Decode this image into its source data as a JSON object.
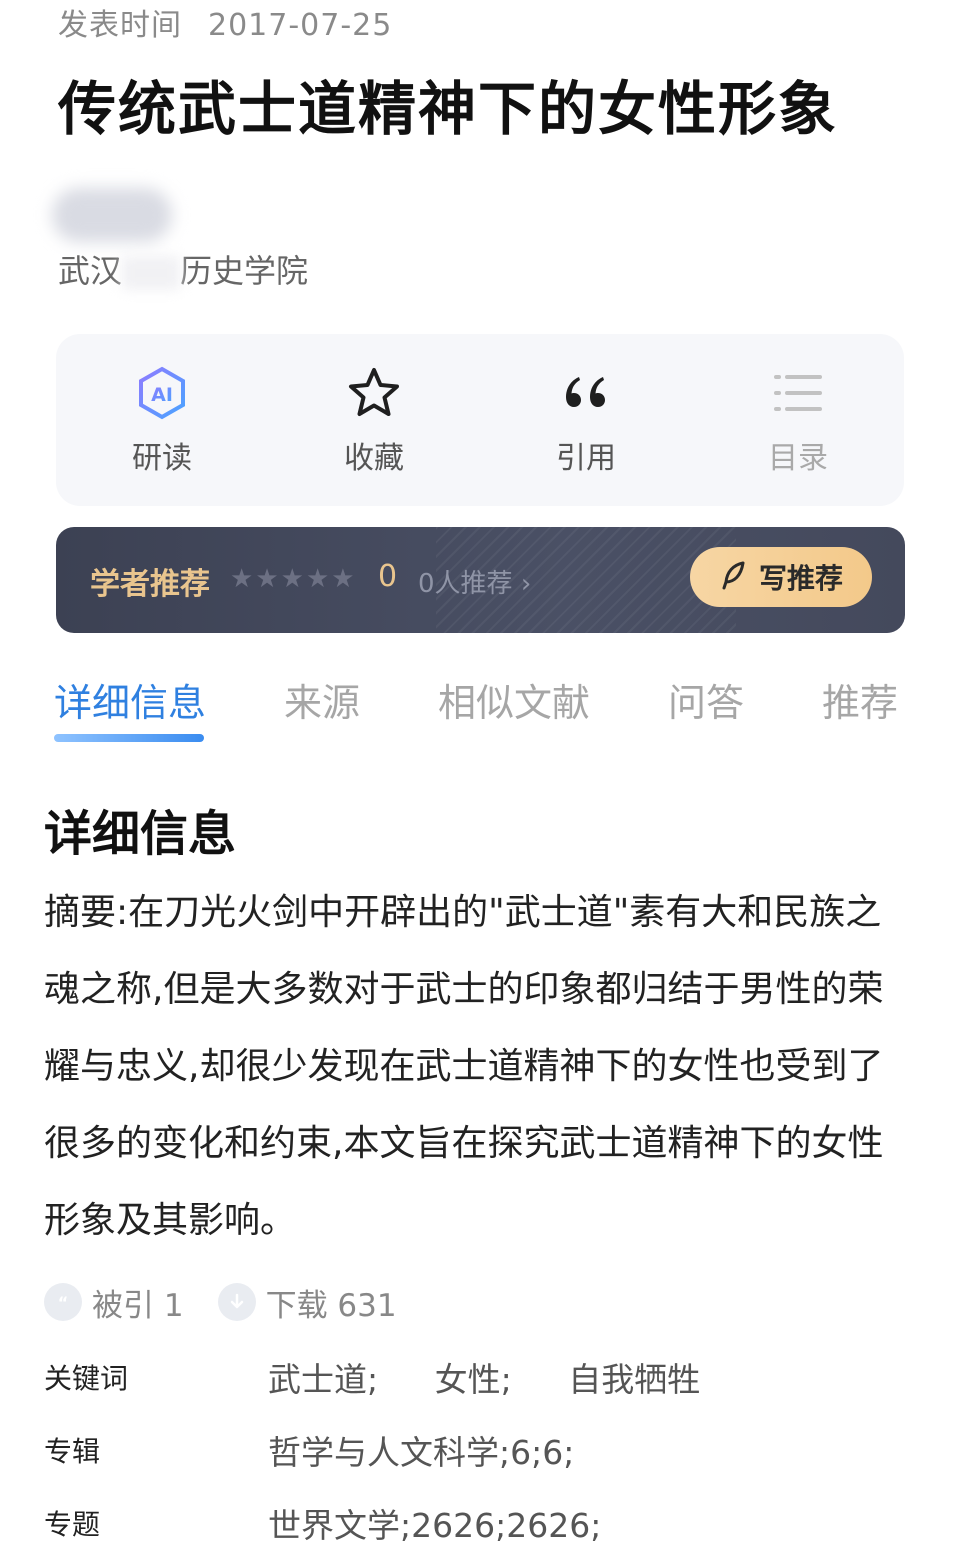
{
  "meta": {
    "published_label": "发表时间",
    "published_date": "2017-07-25"
  },
  "article": {
    "title": "传统武士道精神下的女性形象",
    "institution_prefix": "武汉",
    "institution_suffix": "历史学院"
  },
  "actions": [
    {
      "label": "研读",
      "icon": "ai-read-icon"
    },
    {
      "label": "收藏",
      "icon": "star-icon"
    },
    {
      "label": "引用",
      "icon": "quote-icon"
    },
    {
      "label": "目录",
      "icon": "list-icon"
    }
  ],
  "recommend": {
    "title": "学者推荐",
    "stars": 5,
    "score": "0",
    "count_text": "0人推荐",
    "button_label": "写推荐",
    "accent": "#e9c58e",
    "button_color": "#f3c98a"
  },
  "tabs": [
    {
      "label": "详细信息",
      "active": true
    },
    {
      "label": "来源",
      "active": false
    },
    {
      "label": "相似文献",
      "active": false
    },
    {
      "label": "问答",
      "active": false
    },
    {
      "label": "推荐",
      "active": false
    }
  ],
  "details": {
    "section_title": "详细信息",
    "abstract": "摘要:在刀光火剑中开辟出的\"武士道\"素有大和民族之魂之称,但是大多数对于武士的印象都归结于男性的荣耀与忠义,却很少发现在武士道精神下的女性也受到了很多的变化和约束,本文旨在探究武士道精神下的女性形象及其影响。",
    "cited": "被引 1",
    "downloads": "下载 631",
    "keywords_label": "关键词",
    "keywords": [
      "武士道;",
      "女性;",
      "自我牺牲"
    ],
    "album_label": "专辑",
    "album_value": "哲学与人文科学;6;6;",
    "topic_label": "专题",
    "topic_value": "世界文学;2626;2626;"
  },
  "colors": {
    "active_tab": "#2f80e0",
    "recommend_bg": "#3c4153"
  }
}
